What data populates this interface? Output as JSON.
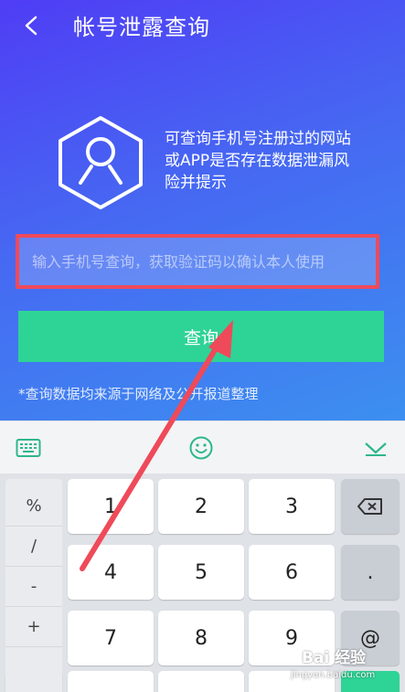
{
  "header": {
    "title": "帐号泄露查询"
  },
  "intro": {
    "description": "可查询手机号注册过的网站或APP是否存在数据泄漏风险并提示"
  },
  "form": {
    "phone_placeholder": "输入手机号查询，获取验证码以确认本人使用",
    "phone_value": "",
    "query_label": "查询"
  },
  "footnote": "*查询数据均来源于网络及公开报道整理",
  "colors": {
    "gradient_start": "#4f3df5",
    "gradient_end": "#3c8ff0",
    "button_green": "#2ed396",
    "highlight_red": "#ef4a5a",
    "annotation_arrow": "#ef4a5a"
  },
  "keyboard": {
    "toolbar_icons": [
      "keyboard-switch-icon",
      "emoji-icon",
      "collapse-keyboard-icon"
    ],
    "side_keys": [
      "%",
      "/",
      "-",
      "+"
    ],
    "rows": [
      [
        "1",
        "2",
        "3"
      ],
      [
        "4",
        "5",
        "6"
      ],
      [
        "7",
        "8",
        "9"
      ]
    ],
    "right_keys": [
      "backspace-icon",
      ".",
      "@"
    ]
  },
  "watermark": {
    "brand": "Bai 经验",
    "url": "jingyan.baidu.com"
  }
}
